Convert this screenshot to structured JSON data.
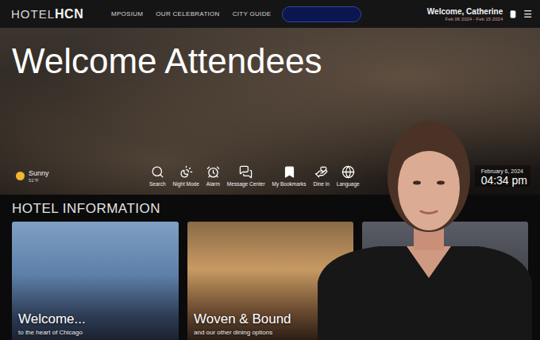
{
  "nav": {
    "logo": {
      "light": "HOTEL",
      "bold": "HCN"
    },
    "items": [
      {
        "label": "MPOSIUM",
        "selected": false
      },
      {
        "label": "OUR CELEBRATION",
        "selected": false
      },
      {
        "label": "CITY GUIDE",
        "selected": false
      }
    ],
    "user": {
      "greeting": "Welcome, Catherine",
      "dates": "Feb 06 2024 - Feb 15 2024"
    },
    "menu_icon": "☰"
  },
  "hero": {
    "title": "Welcome Attendees"
  },
  "weather": {
    "condition": "Sunny",
    "temperature": "51°F"
  },
  "toolbar": [
    {
      "label": "Search"
    },
    {
      "label": "Night Mode"
    },
    {
      "label": "Alarm"
    },
    {
      "label": "Message Center"
    },
    {
      "label": "My Bookmarks"
    },
    {
      "label": "Dine in"
    },
    {
      "label": "Language"
    }
  ],
  "clock": {
    "date": "February 6, 2024",
    "time": "04:34 pm"
  },
  "section": {
    "title": "HOTEL INFORMATION"
  },
  "cards": [
    {
      "title": "Welcome...",
      "subtitle": "to the heart of Chicago"
    },
    {
      "title": "Woven & Bound",
      "subtitle": "and our other dining options"
    }
  ]
}
